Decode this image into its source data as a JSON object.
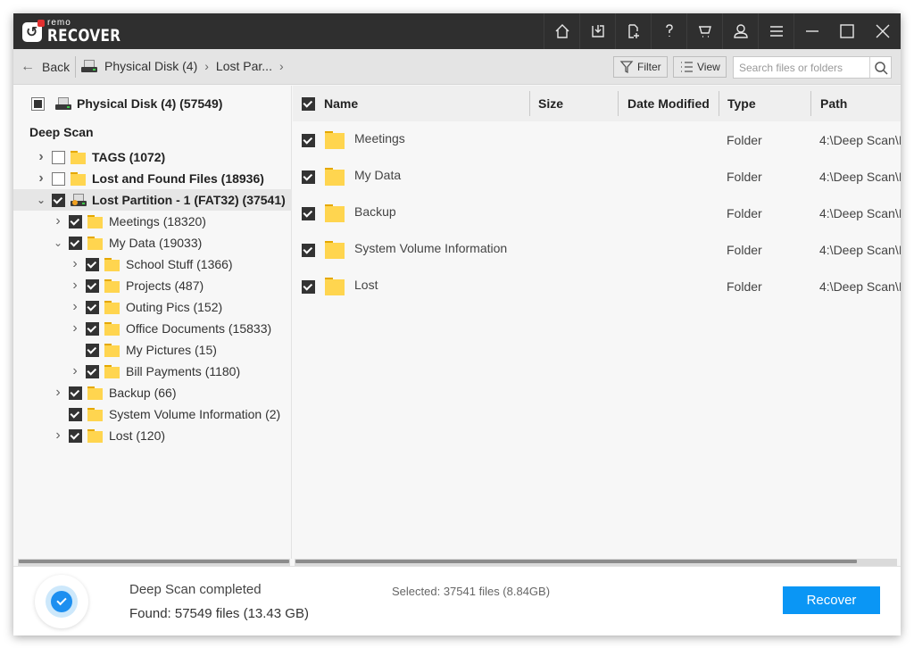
{
  "app": {
    "brand_small": "remo",
    "brand_big": "RECOVER",
    "title_icons": [
      "home-icon",
      "import-icon",
      "new-file-icon",
      "help-icon",
      "cart-icon",
      "user-icon",
      "menu-icon",
      "minimize-icon",
      "maximize-icon",
      "close-icon"
    ]
  },
  "toolbar": {
    "back_label": "Back",
    "breadcrumbs": [
      "Physical Disk (4)",
      "Lost Par..."
    ],
    "filter_label": "Filter",
    "view_label": "View",
    "search_placeholder": "Search files or folders",
    "search_value": ""
  },
  "tree": {
    "root_label": "Physical Disk (4) (57549)",
    "section_label": "Deep Scan",
    "nodes": [
      {
        "label": "TAGS (1072)",
        "level": 0,
        "expander": "collapsed",
        "checked": false,
        "icon": "folder",
        "bold": true
      },
      {
        "label": "Lost and Found Files (18936)",
        "level": 0,
        "expander": "collapsed",
        "checked": false,
        "icon": "folder",
        "bold": true
      },
      {
        "label": "Lost Partition - 1 (FAT32) (37541)",
        "level": 0,
        "expander": "expanded",
        "checked": true,
        "icon": "drive",
        "bold": true,
        "selected": true
      },
      {
        "label": "Meetings (18320)",
        "level": 1,
        "expander": "collapsed",
        "checked": true,
        "icon": "folder"
      },
      {
        "label": "My Data (19033)",
        "level": 1,
        "expander": "expanded",
        "checked": true,
        "icon": "folder"
      },
      {
        "label": "School Stuff (1366)",
        "level": 2,
        "expander": "collapsed",
        "checked": true,
        "icon": "folder"
      },
      {
        "label": "Projects (487)",
        "level": 2,
        "expander": "collapsed",
        "checked": true,
        "icon": "folder"
      },
      {
        "label": "Outing Pics (152)",
        "level": 2,
        "expander": "collapsed",
        "checked": true,
        "icon": "folder"
      },
      {
        "label": "Office Documents (15833)",
        "level": 2,
        "expander": "collapsed",
        "checked": true,
        "icon": "folder"
      },
      {
        "label": "My Pictures (15)",
        "level": 2,
        "expander": "none",
        "checked": true,
        "icon": "folder"
      },
      {
        "label": "Bill Payments (1180)",
        "level": 2,
        "expander": "collapsed",
        "checked": true,
        "icon": "folder"
      },
      {
        "label": "Backup (66)",
        "level": 1,
        "expander": "collapsed",
        "checked": true,
        "icon": "folder"
      },
      {
        "label": "System Volume Information (2)",
        "level": 1,
        "expander": "none",
        "checked": true,
        "icon": "folder"
      },
      {
        "label": "Lost (120)",
        "level": 1,
        "expander": "collapsed",
        "checked": true,
        "icon": "folder"
      }
    ]
  },
  "table": {
    "columns": [
      "Name",
      "Size",
      "Date Modified",
      "Type",
      "Path"
    ],
    "rows": [
      {
        "name": "Meetings",
        "size": "",
        "date": "",
        "type": "Folder",
        "path": "4:\\Deep Scan\\I",
        "checked": true
      },
      {
        "name": "My Data",
        "size": "",
        "date": "",
        "type": "Folder",
        "path": "4:\\Deep Scan\\I",
        "checked": true
      },
      {
        "name": "Backup",
        "size": "",
        "date": "",
        "type": "Folder",
        "path": "4:\\Deep Scan\\I",
        "checked": true
      },
      {
        "name": "System Volume Information",
        "size": "",
        "date": "",
        "type": "Folder",
        "path": "4:\\Deep Scan\\I",
        "checked": true
      },
      {
        "name": "Lost",
        "size": "",
        "date": "",
        "type": "Folder",
        "path": "4:\\Deep Scan\\I",
        "checked": true
      }
    ]
  },
  "status": {
    "title": "Deep Scan completed",
    "found": "Found: 57549 files (13.43 GB)",
    "selected": "Selected: 37541 files (8.84GB)",
    "recover_label": "Recover"
  },
  "colors": {
    "titlebar": "#2f2f2f",
    "accent": "#0a96f5",
    "folder": "#ffd54f",
    "brand_red": "#e23030"
  }
}
